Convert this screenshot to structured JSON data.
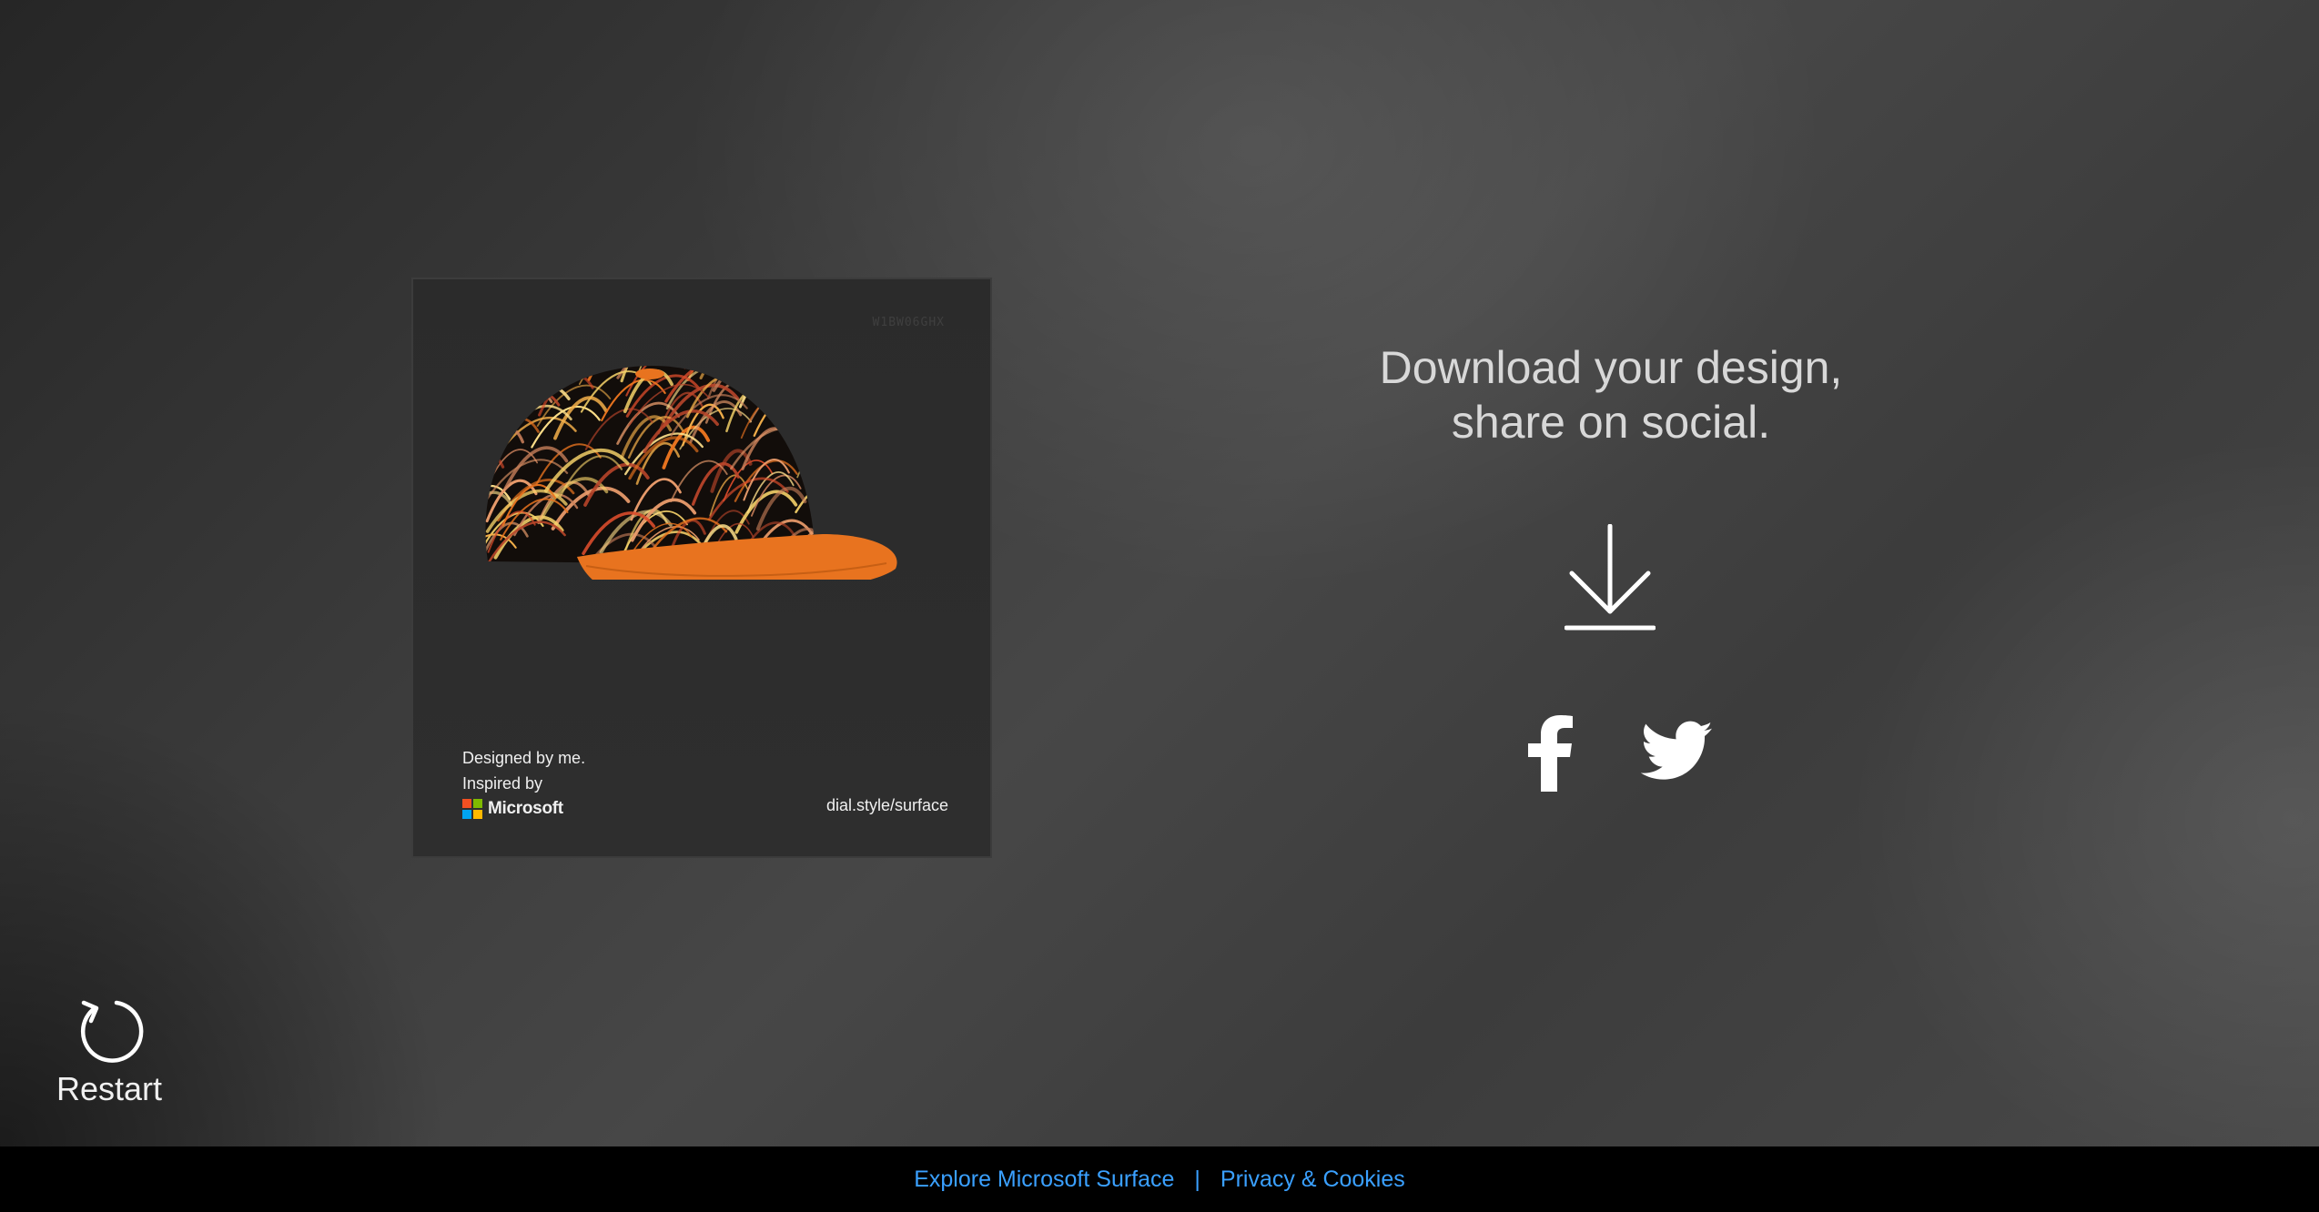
{
  "card": {
    "code": "W1BW06GHX",
    "designed_by": "Designed by me.",
    "inspired_by": "Inspired by",
    "brand": "Microsoft",
    "url": "dial.style/surface",
    "brand_colors": [
      "#f25022",
      "#7fba00",
      "#00a4ef",
      "#ffb900"
    ],
    "cap_brim_color": "#e8731f"
  },
  "share": {
    "headline_line1": "Download your design,",
    "headline_line2": "share on social.",
    "download_icon": "download-icon",
    "facebook_icon": "facebook-icon",
    "twitter_icon": "twitter-icon"
  },
  "restart": {
    "label": "Restart",
    "icon": "restart-icon"
  },
  "footer": {
    "link1": "Explore Microsoft Surface",
    "separator": "|",
    "link2": "Privacy & Cookies",
    "link_color": "#3aa0ff"
  }
}
